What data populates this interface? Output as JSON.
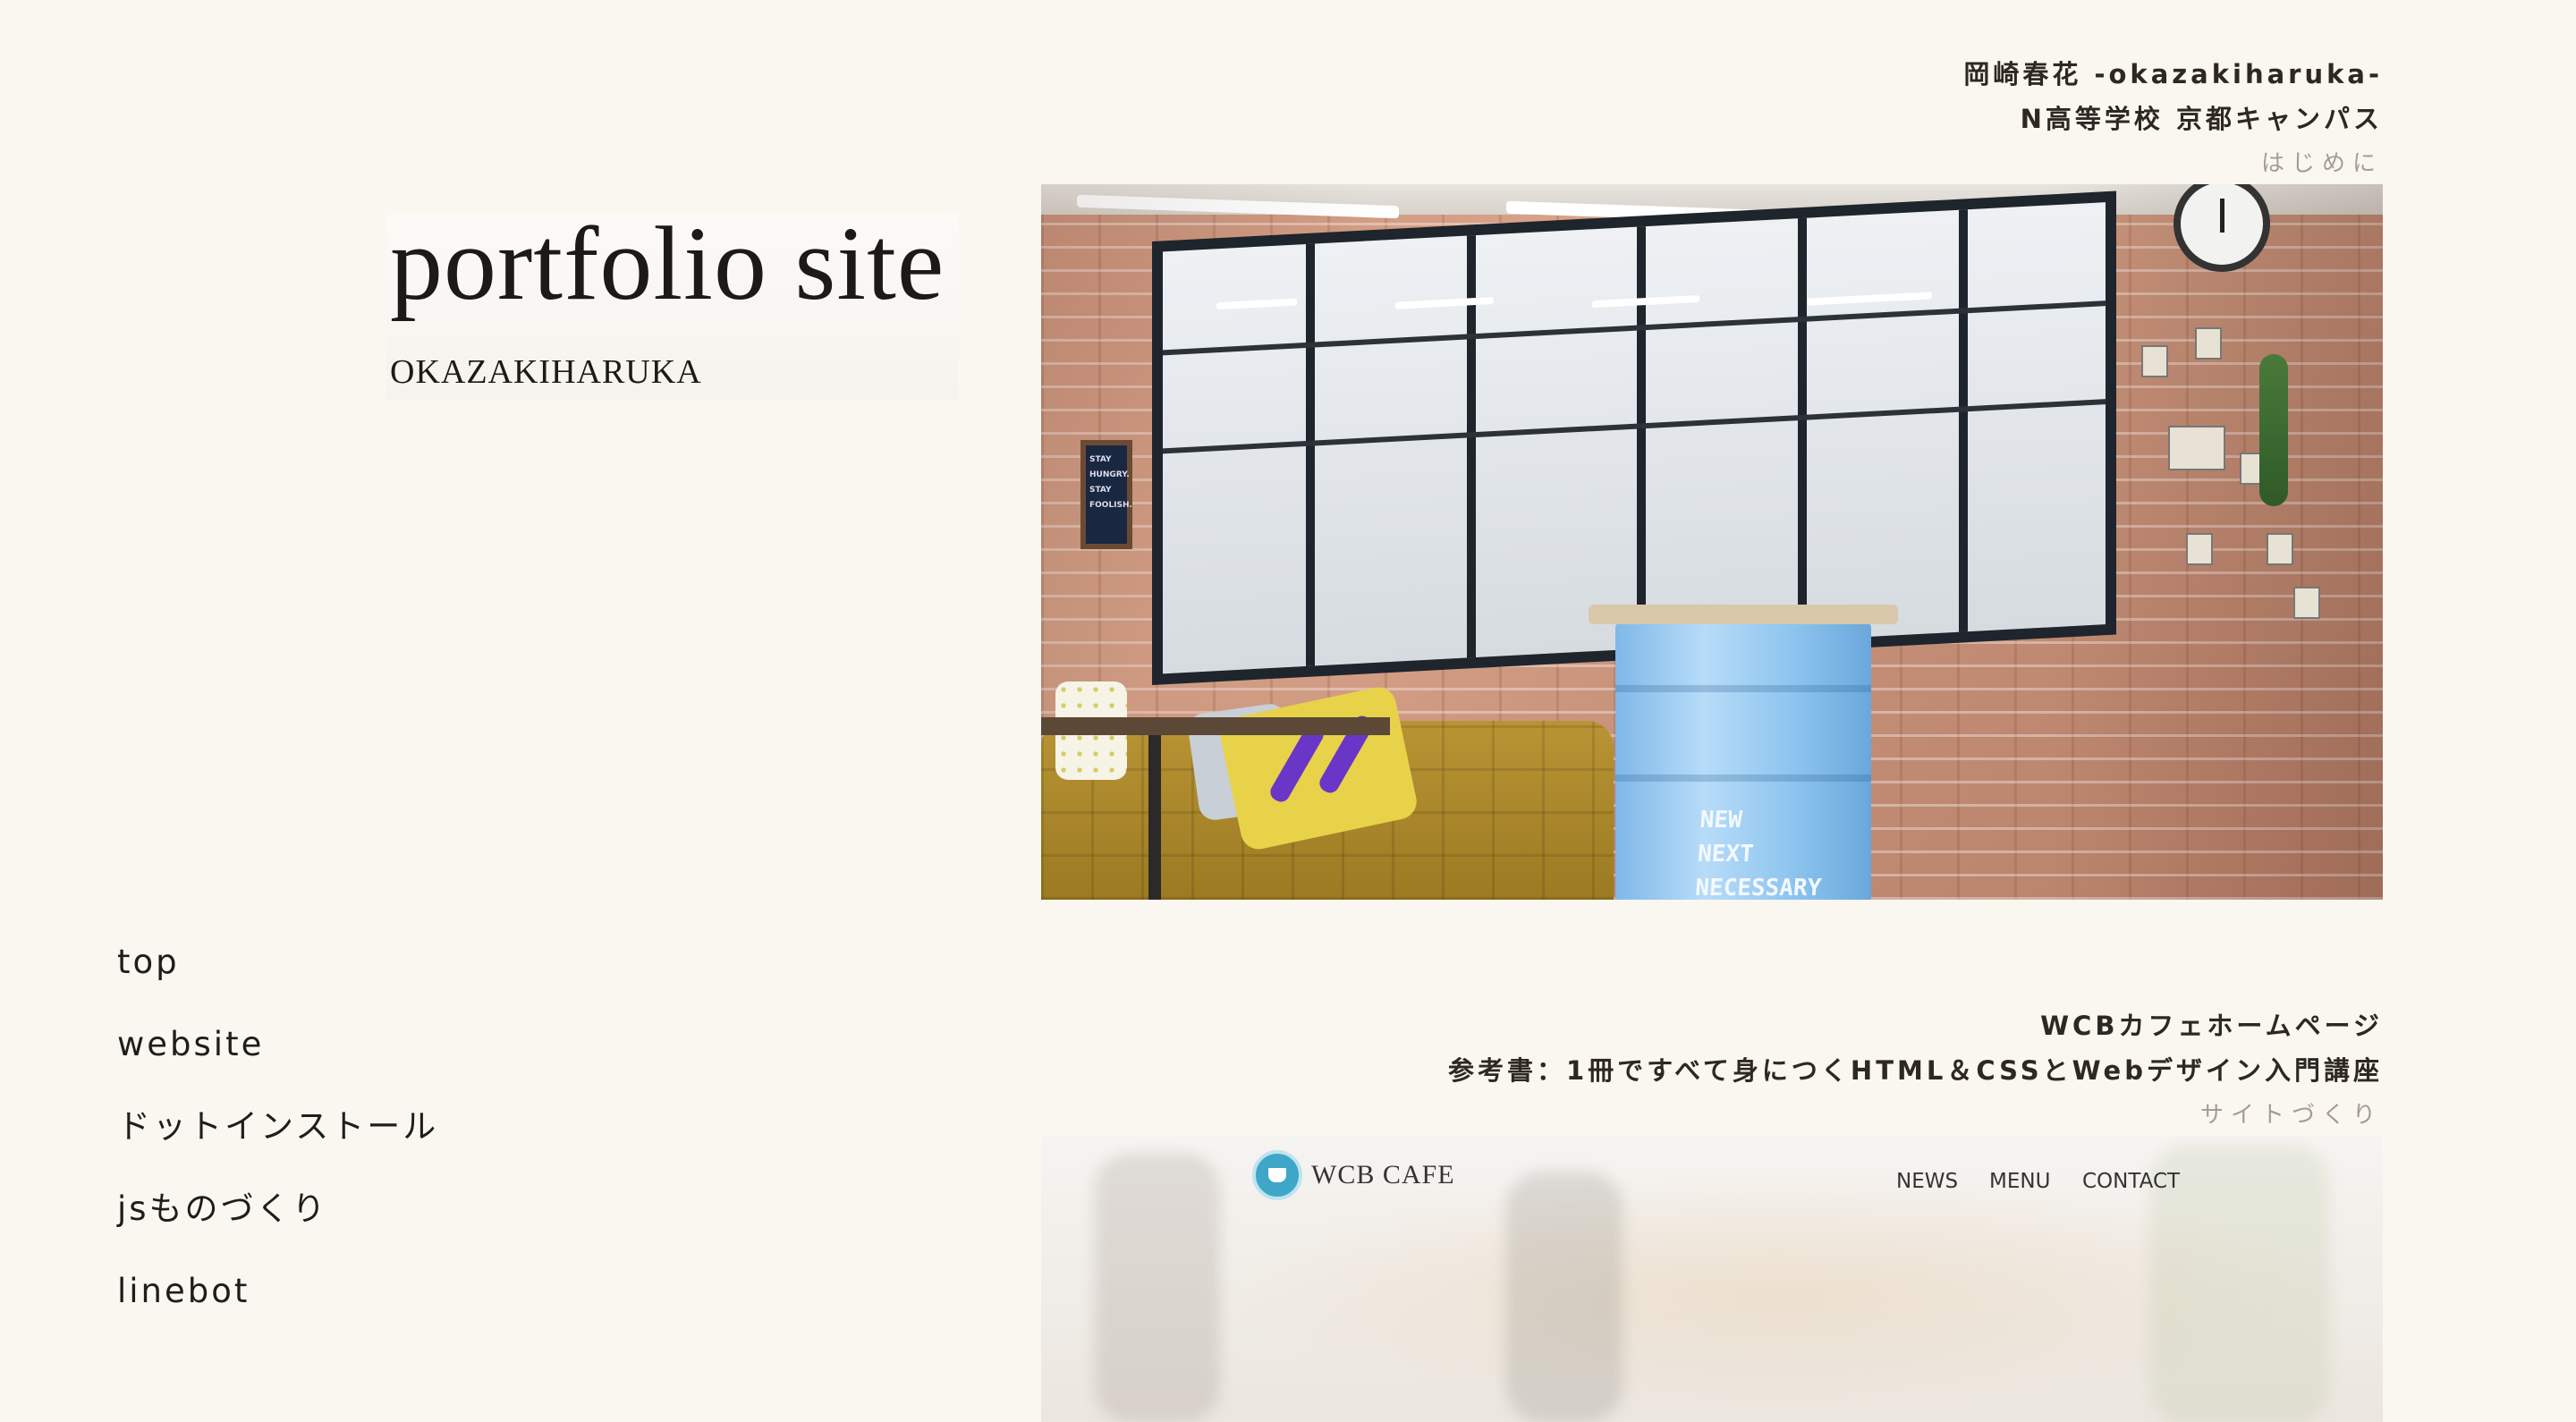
{
  "logo": {
    "title": "portfolio site",
    "subtitle": "OKAZAKIHARUKA"
  },
  "nav": {
    "items": [
      {
        "label": "top"
      },
      {
        "label": "website"
      },
      {
        "label": "ドットインストール"
      },
      {
        "label": "jsものづくり"
      },
      {
        "label": "linebot"
      }
    ]
  },
  "works": [
    {
      "title": "岡崎春花 -okazakiharuka-",
      "subtitle": "N高等学校 京都キャンパス",
      "category": "はじめに",
      "photo": {
        "sign_text": "STAY HUNGRY. STAY FOOLISH.",
        "drum_text": [
          "NEW",
          "NEXT",
          "NECESSARY"
        ]
      }
    },
    {
      "title": "WCBカフェホームページ",
      "subtitle": "参考書：1冊ですべて身につくHTML＆CSSとWebデザイン入門講座",
      "category": "サイトづくり",
      "screenshot": {
        "brand": "WCB CAFE",
        "nav": [
          "NEWS",
          "MENU",
          "CONTACT"
        ],
        "accent": "#3ea6c9"
      }
    }
  ]
}
